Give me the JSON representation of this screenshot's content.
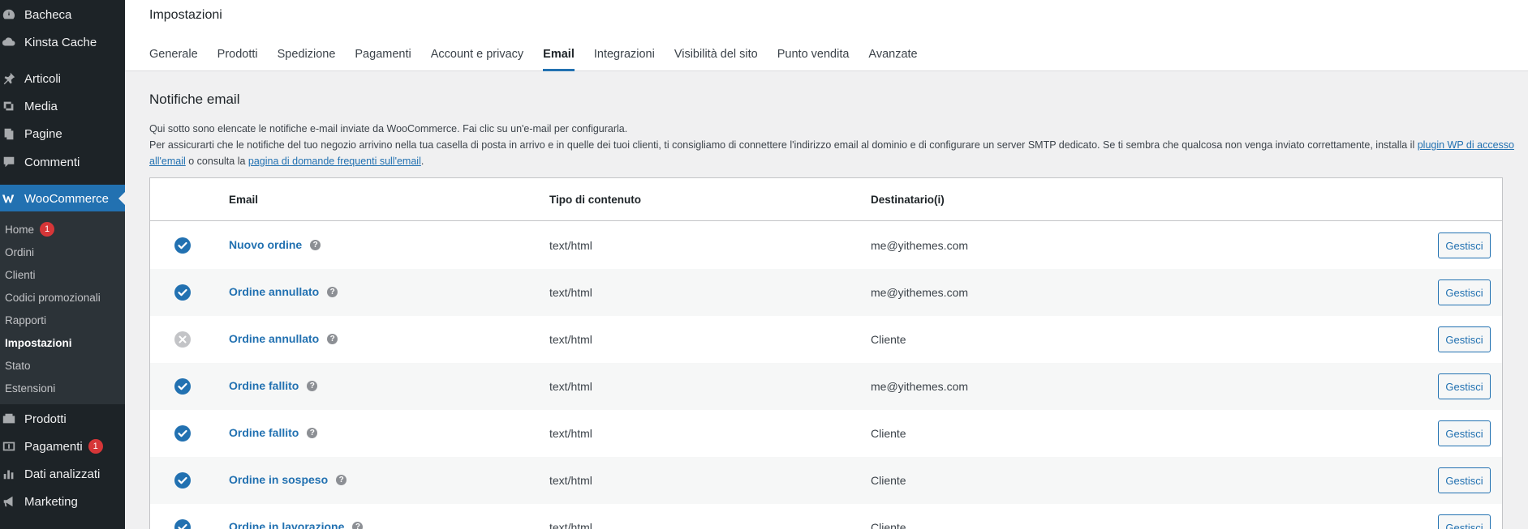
{
  "sidebar": {
    "items": [
      {
        "label": "Bacheca",
        "icon": "dashboard-icon"
      },
      {
        "label": "Kinsta Cache",
        "icon": "cloud-icon"
      },
      {
        "label": "Articoli",
        "icon": "pin-icon"
      },
      {
        "label": "Media",
        "icon": "media-icon"
      },
      {
        "label": "Pagine",
        "icon": "pages-icon"
      },
      {
        "label": "Commenti",
        "icon": "comments-icon"
      },
      {
        "label": "WooCommerce",
        "icon": "woocommerce-icon"
      },
      {
        "label": "Prodotti",
        "icon": "products-icon"
      },
      {
        "label": "Pagamenti",
        "icon": "payments-icon",
        "badge": "1"
      },
      {
        "label": "Dati analizzati",
        "icon": "analytics-icon"
      },
      {
        "label": "Marketing",
        "icon": "megaphone-icon"
      }
    ],
    "submenu": [
      {
        "label": "Home",
        "badge": "1"
      },
      {
        "label": "Ordini"
      },
      {
        "label": "Clienti"
      },
      {
        "label": "Codici promozionali"
      },
      {
        "label": "Rapporti"
      },
      {
        "label": "Impostazioni",
        "active": true
      },
      {
        "label": "Stato"
      },
      {
        "label": "Estensioni"
      }
    ]
  },
  "header": {
    "title": "Impostazioni",
    "tabs": [
      {
        "label": "Generale"
      },
      {
        "label": "Prodotti"
      },
      {
        "label": "Spedizione"
      },
      {
        "label": "Pagamenti"
      },
      {
        "label": "Account e privacy"
      },
      {
        "label": "Email",
        "active": true
      },
      {
        "label": "Integrazioni"
      },
      {
        "label": "Visibilità del sito"
      },
      {
        "label": "Punto vendita"
      },
      {
        "label": "Avanzate"
      }
    ]
  },
  "main": {
    "section_title": "Notifiche email",
    "desc_line1": "Qui sotto sono elencate le notifiche e-mail inviate da WooCommerce. Fai clic su un'e-mail per configurarla.",
    "desc_line2_prefix": "Per assicurarti che le notifiche del tuo negozio arrivino nella tua casella di posta in arrivo e in quelle dei tuoi clienti, ti consigliamo di connettere l'indirizzo email al dominio e di configurare un server SMTP dedicato. Se ti sembra che qualcosa non venga inviato correttamente, installa il ",
    "desc_link1": "plugin WP di accesso all'email",
    "desc_mid": " o consulta la ",
    "desc_link2": "pagina di domande frequenti sull'email",
    "desc_suffix": "."
  },
  "table": {
    "headers": {
      "email": "Email",
      "type": "Tipo di contenuto",
      "recipient": "Destinatario(i)"
    },
    "help_glyph": "?",
    "rows": [
      {
        "enabled": true,
        "name": "Nuovo ordine",
        "type": "text/html",
        "recipient": "me@yithemes.com",
        "action": "Gestisci"
      },
      {
        "enabled": true,
        "name": "Ordine annullato",
        "type": "text/html",
        "recipient": "me@yithemes.com",
        "action": "Gestisci"
      },
      {
        "enabled": false,
        "name": "Ordine annullato",
        "type": "text/html",
        "recipient": "Cliente",
        "action": "Gestisci"
      },
      {
        "enabled": true,
        "name": "Ordine fallito",
        "type": "text/html",
        "recipient": "me@yithemes.com",
        "action": "Gestisci"
      },
      {
        "enabled": true,
        "name": "Ordine fallito",
        "type": "text/html",
        "recipient": "Cliente",
        "action": "Gestisci"
      },
      {
        "enabled": true,
        "name": "Ordine in sospeso",
        "type": "text/html",
        "recipient": "Cliente",
        "action": "Gestisci"
      },
      {
        "enabled": true,
        "name": "Ordine in lavorazione",
        "type": "text/html",
        "recipient": "Cliente",
        "action": "Gestisci"
      }
    ]
  },
  "colors": {
    "sidebar_bg": "#1d2327",
    "accent": "#2271b1",
    "badge": "#d63638",
    "disabled_icon": "#c3c4c7"
  }
}
